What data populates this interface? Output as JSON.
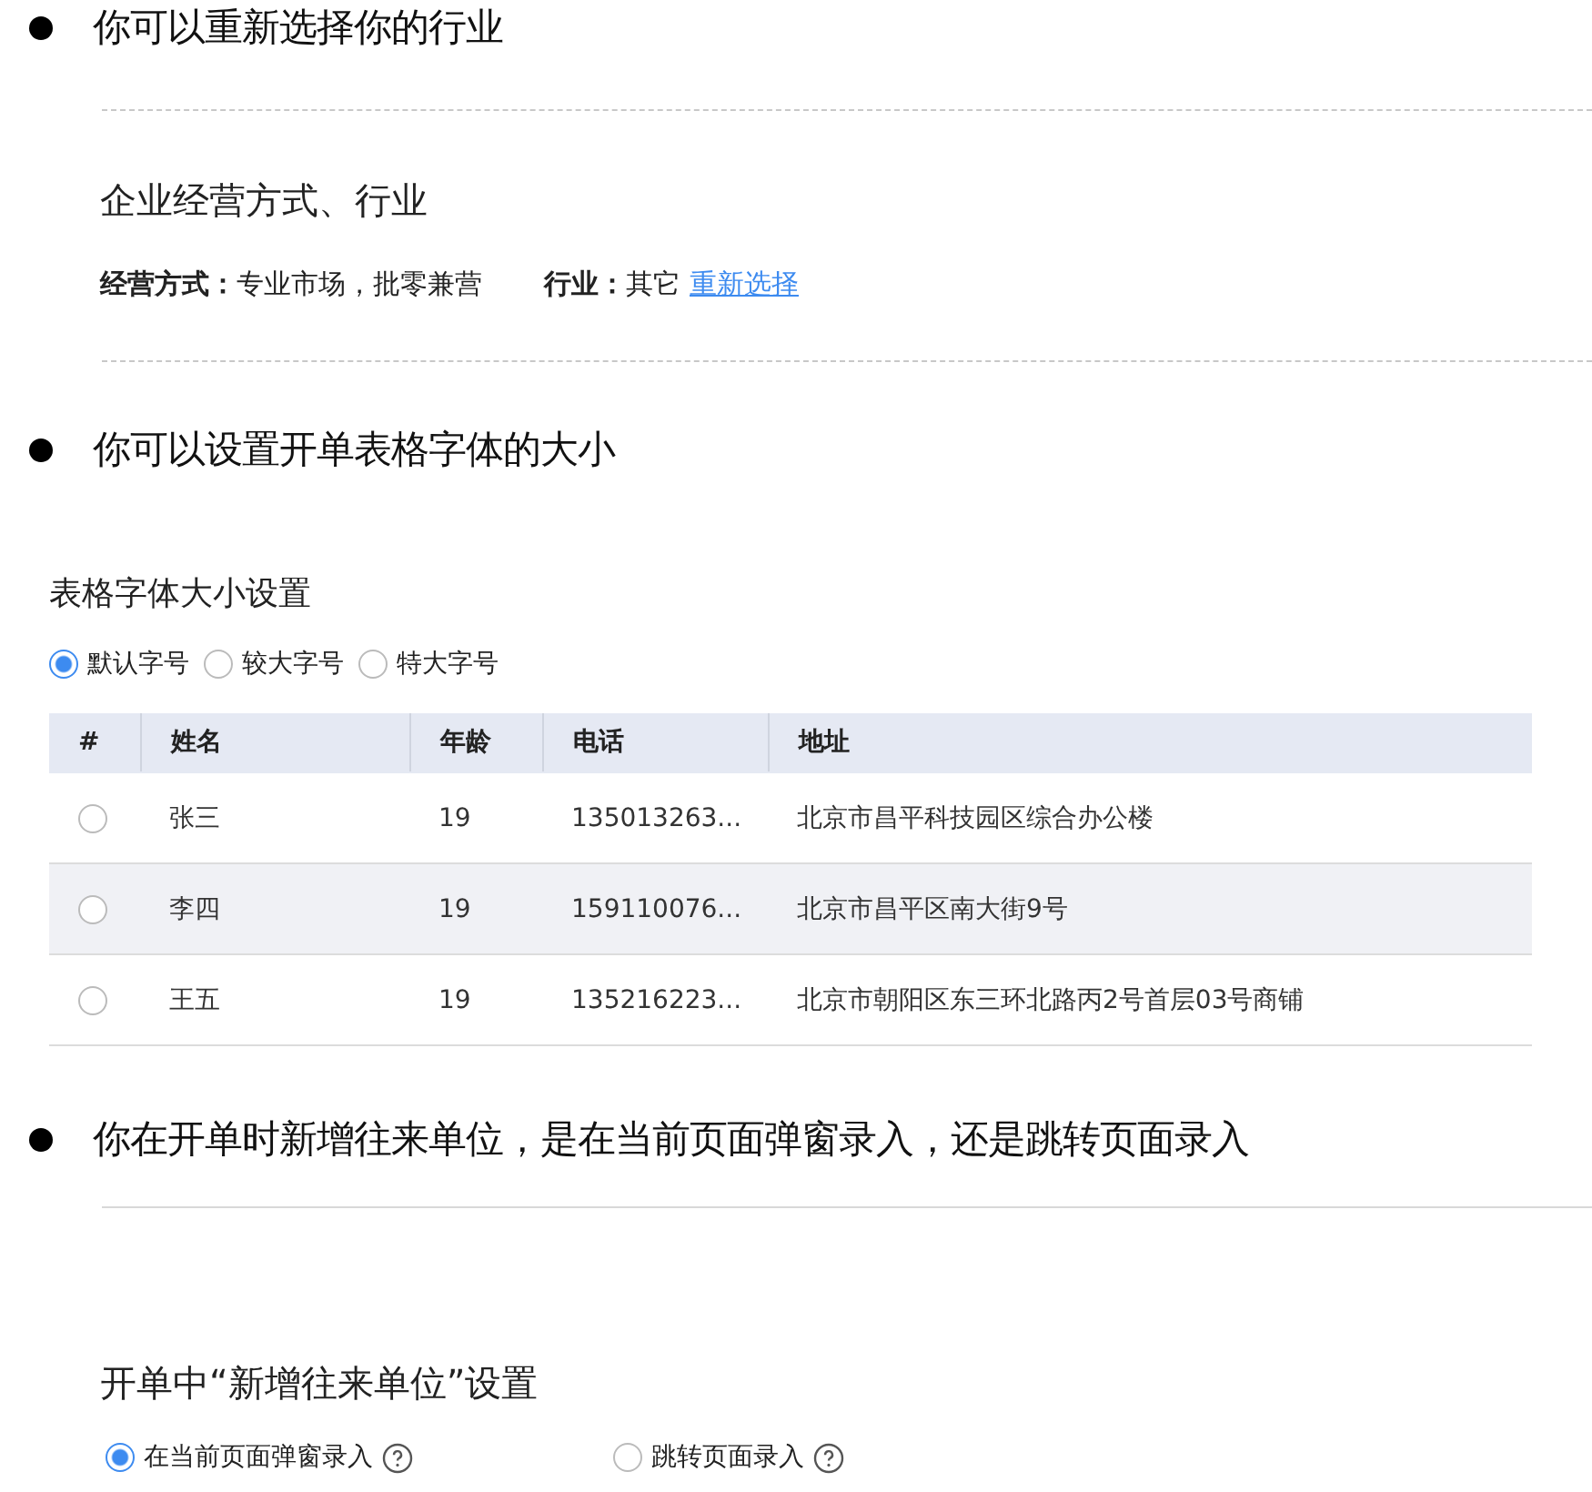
{
  "sections": [
    {
      "bullet": "你可以重新选择你的行业",
      "divider_dashed": true,
      "title": "企业经营方式、行业",
      "info": [
        {
          "label": "经营方式：",
          "value": "专业市场，批零兼营"
        },
        {
          "label": "行业：",
          "value": "其它",
          "link": "重新选择"
        }
      ]
    },
    {
      "bullet": "你可以设置开单表格字体的大小",
      "title": "表格字体大小设置",
      "options": [
        {
          "label": "默认字号",
          "selected": true
        },
        {
          "label": "较大字号",
          "selected": false
        },
        {
          "label": "特大字号",
          "selected": false
        }
      ],
      "table": {
        "columns": [
          "#",
          "姓名",
          "年龄",
          "电话",
          "地址"
        ],
        "rows": [
          {
            "selected": false,
            "highlighted": false,
            "cells": [
              "",
              "张三",
              "19",
              "135013263...",
              "北京市昌平科技园区综合办公楼"
            ]
          },
          {
            "selected": false,
            "highlighted": true,
            "cells": [
              "",
              "李四",
              "19",
              "159110076...",
              "北京市昌平区南大街9号"
            ]
          },
          {
            "selected": false,
            "highlighted": false,
            "cells": [
              "",
              "王五",
              "19",
              "135216223...",
              "北京市朝阳区东三环北路丙2号首层03号商铺"
            ]
          }
        ]
      }
    },
    {
      "bullet": "你在开单时新增往来单位，是在当前页面弹窗录入，还是跳转页面录入",
      "divider_dashed": false,
      "title": "开单中“新增往来单位”设置",
      "options": [
        {
          "label": "在当前页面弹窗录入",
          "selected": true,
          "help": true
        },
        {
          "label": "跳转页面录入",
          "selected": false,
          "help": true
        }
      ]
    }
  ]
}
